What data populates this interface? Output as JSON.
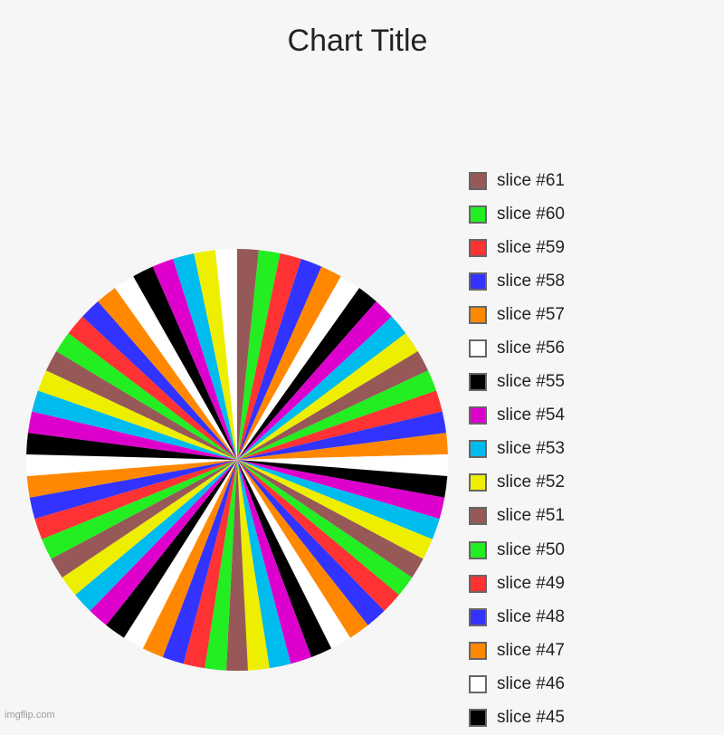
{
  "chart_data": {
    "type": "pie",
    "title": "Chart Title",
    "start": "top",
    "direction": "clockwise",
    "palette": {
      "brown": "#975858",
      "green": "#22ee22",
      "red": "#ff3333",
      "blue": "#3333ff",
      "orange": "#ff8800",
      "white": "#ffffff",
      "black": "#000000",
      "magenta": "#dd00cc",
      "cyan": "#00bbee",
      "yellow": "#eeee00"
    },
    "cycle": [
      "brown",
      "green",
      "red",
      "blue",
      "orange",
      "white",
      "black",
      "magenta",
      "cyan",
      "yellow"
    ],
    "slices_clockwise_from_top_count": 61,
    "slice_value_each": 1,
    "last_slice_color": "white",
    "legend_visible": [
      {
        "label": "slice #61",
        "color": "#975858"
      },
      {
        "label": "slice #60",
        "color": "#22ee22"
      },
      {
        "label": "slice #59",
        "color": "#ff3333"
      },
      {
        "label": "slice #58",
        "color": "#3333ff"
      },
      {
        "label": "slice #57",
        "color": "#ff8800"
      },
      {
        "label": "slice #56",
        "color": "#ffffff"
      },
      {
        "label": "slice #55",
        "color": "#000000"
      },
      {
        "label": "slice #54",
        "color": "#dd00cc"
      },
      {
        "label": "slice #53",
        "color": "#00bbee"
      },
      {
        "label": "slice #52",
        "color": "#eeee00"
      },
      {
        "label": "slice #51",
        "color": "#975858"
      },
      {
        "label": "slice #50",
        "color": "#22ee22"
      },
      {
        "label": "slice #49",
        "color": "#ff3333"
      },
      {
        "label": "slice #48",
        "color": "#3333ff"
      },
      {
        "label": "slice #47",
        "color": "#ff8800"
      },
      {
        "label": "slice #46",
        "color": "#ffffff"
      },
      {
        "label": "slice #45",
        "color": "#000000"
      }
    ],
    "legend_placement": "right"
  },
  "watermark": "imgflip.com"
}
